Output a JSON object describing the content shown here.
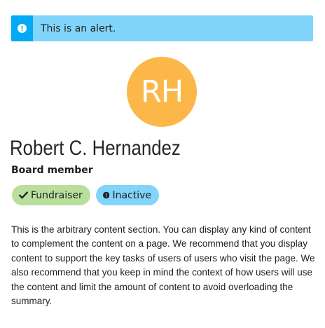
{
  "alert": {
    "icon": "exclamation-circle-icon",
    "text": "This is an alert."
  },
  "profile": {
    "initials": "RH",
    "name": "Robert C. Hernandez",
    "role": "Board member"
  },
  "badges": [
    {
      "icon": "check-icon",
      "label": "Fundraiser",
      "color": "#b9df9d"
    },
    {
      "icon": "exclamation-circle-icon",
      "label": "Inactive",
      "color": "#81d4fa"
    }
  ],
  "content": "This is the arbitrary content section. You can display any kind of content to complement the content on a page. We recommend that you display content to support the key tasks of users of users who visit the page. We also recommend that you keep in mind the context of how users will use the content and limit the amount of content to avoid overloading the summary.",
  "colors": {
    "alert_bg": "#81d4fa",
    "alert_icon_bg": "#03a9f4",
    "avatar_bg": "#fbb848",
    "badge_green": "#b9df9d",
    "badge_blue": "#81d4fa"
  }
}
